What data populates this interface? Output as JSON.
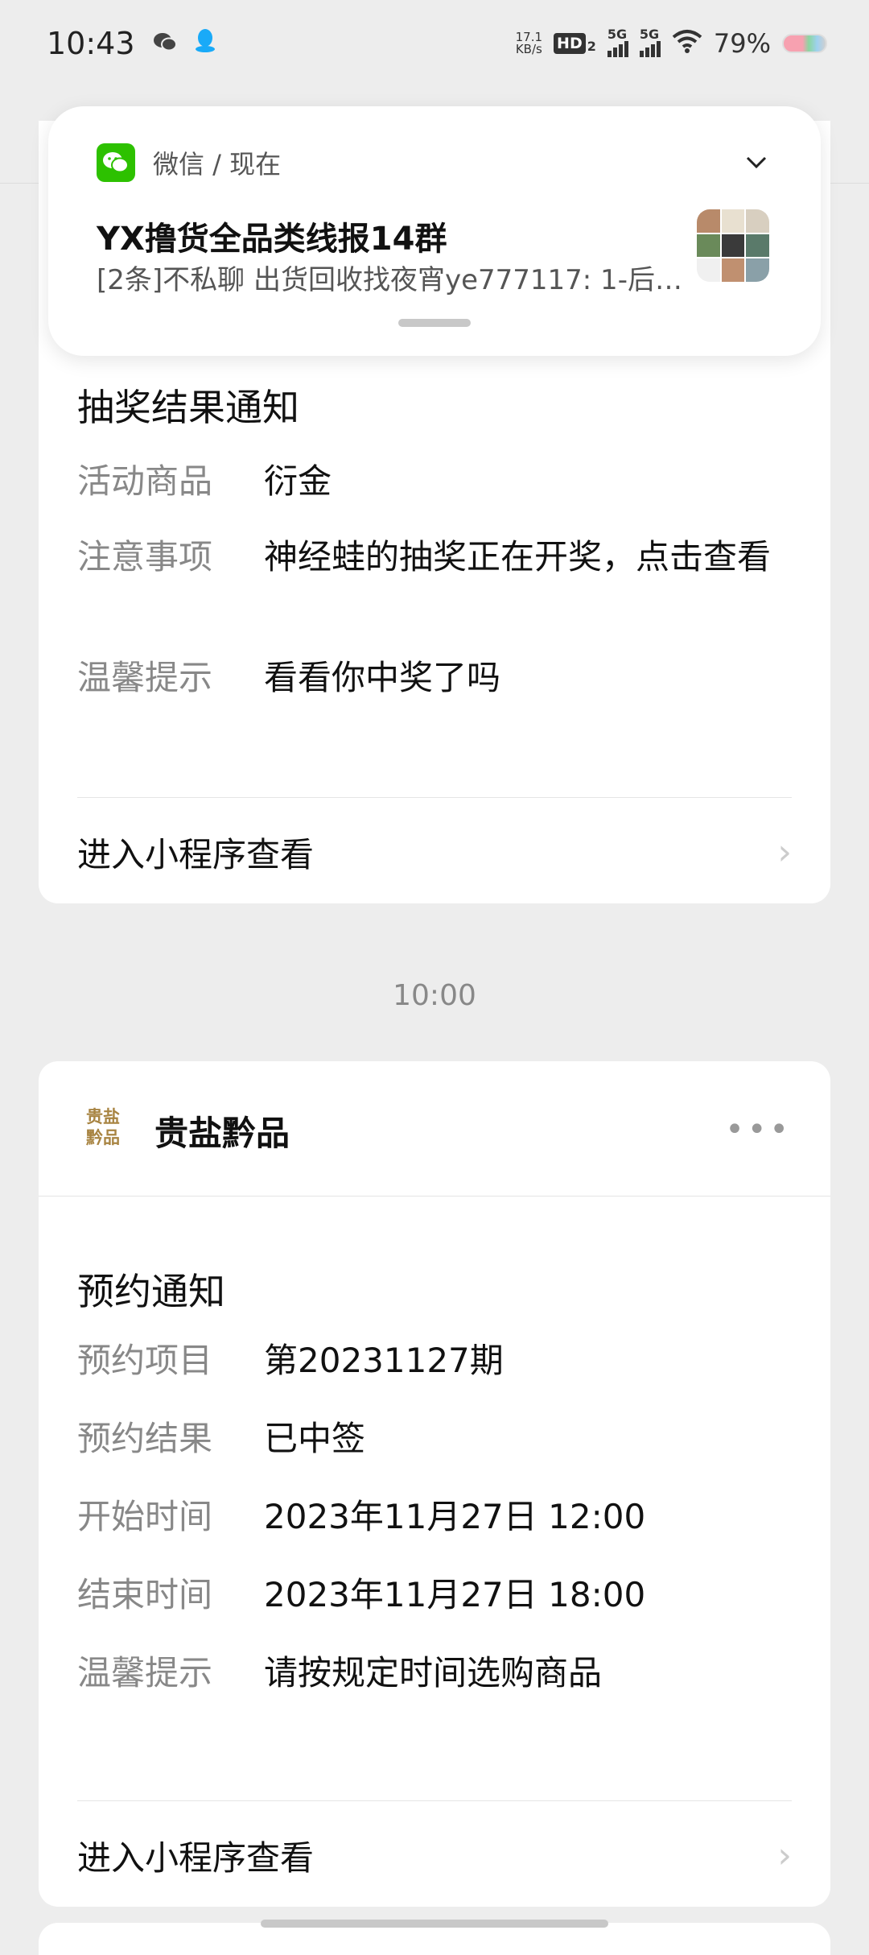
{
  "status_bar": {
    "time": "10:43",
    "net_speed_value": "17.1",
    "net_speed_unit": "KB/s",
    "hd_label": "HD",
    "hd_sub": "2",
    "signal1_label": "5G",
    "signal2_label": "5G",
    "battery": "79%",
    "icons": [
      "wechat-status-icon",
      "qq-status-icon",
      "wifi-icon",
      "battery-icon"
    ]
  },
  "notification": {
    "app_line": "微信 / 现在",
    "title": "YX撸货全品类线报14群",
    "body": "[2条]不私聊 出货回收找夜宵ye777117: 1-后…",
    "accent_color": "#2dc100"
  },
  "card1": {
    "title": "抽奖结果通知",
    "rows": [
      {
        "key": "活动商品",
        "value": "衍金"
      },
      {
        "key": "注意事项",
        "value": "神经蛙的抽奖正在开奖，点击查看"
      },
      {
        "key": "温馨提示",
        "value": "看看你中奖了吗"
      }
    ],
    "link": "进入小程序查看"
  },
  "time_separator": "10:00",
  "card2": {
    "brand_logo_text": "贵盐黔品",
    "brand_name": "贵盐黔品",
    "title": "预约通知",
    "rows": [
      {
        "key": "预约项目",
        "value": "第20231127期"
      },
      {
        "key": "预约结果",
        "value": "已中签"
      },
      {
        "key": "开始时间",
        "value": "2023年11月27日 12:00"
      },
      {
        "key": "结束时间",
        "value": "2023年11月27日 18:00"
      },
      {
        "key": "温馨提示",
        "value": "请按规定时间选购商品"
      }
    ],
    "link": "进入小程序查看"
  }
}
